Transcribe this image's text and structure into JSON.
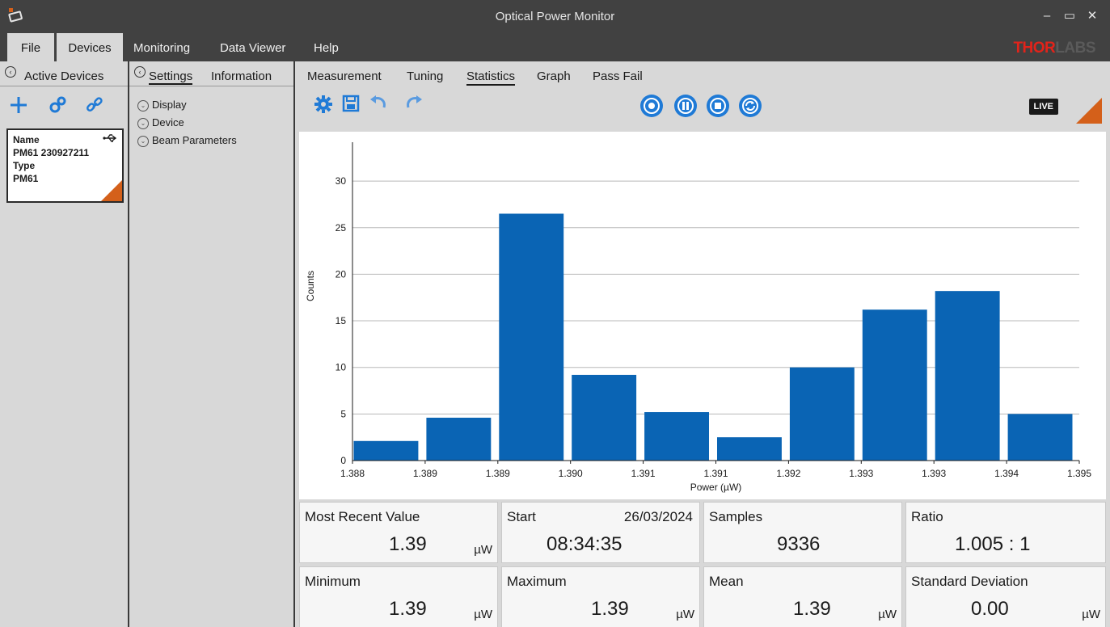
{
  "window": {
    "title": "Optical Power Monitor",
    "minimize": "–",
    "restore": "▭",
    "close": "✕"
  },
  "menu": {
    "file": "File",
    "devices": "Devices",
    "monitoring": "Monitoring",
    "data_viewer": "Data Viewer",
    "help": "Help"
  },
  "brand": {
    "logo_part1": "THOR",
    "logo_part2": "LABS",
    "accent": "#d4601a",
    "primary": "#1f7ad6"
  },
  "devices_panel": {
    "title": "Active Devices",
    "card": {
      "name_label": "Name",
      "name_value": "PM61 230927211",
      "type_label": "Type",
      "type_value": "PM61"
    }
  },
  "settings_panel": {
    "tabs": [
      "Settings",
      "Information"
    ],
    "tree": [
      "Display",
      "Device",
      "Beam Parameters"
    ]
  },
  "main_tabs": [
    "Measurement",
    "Tuning",
    "Statistics",
    "Graph",
    "Pass Fail"
  ],
  "live_label": "LIVE",
  "chart_data": {
    "type": "bar",
    "xlabel": "Power (µW)",
    "ylabel": "Counts",
    "ylim": [
      0,
      34
    ],
    "y_ticks": [
      0,
      5,
      10,
      15,
      20,
      25,
      30
    ],
    "x_ticks": [
      "1.388",
      "1.389",
      "1.389",
      "1.390",
      "1.391",
      "1.391",
      "1.392",
      "1.393",
      "1.393",
      "1.394",
      "1.395"
    ],
    "values": [
      2.1,
      4.6,
      26.5,
      9.2,
      5.2,
      2.5,
      10.0,
      16.2,
      18.2,
      5.0
    ],
    "bar_color": "#0a64b4"
  },
  "stats": {
    "most_recent": {
      "label": "Most Recent Value",
      "value": "1.39",
      "unit": "µW"
    },
    "start": {
      "label": "Start",
      "date": "26/03/2024",
      "time": "08:34:35"
    },
    "samples": {
      "label": "Samples",
      "value": "9336"
    },
    "ratio": {
      "label": "Ratio",
      "value": "1.005 : 1"
    },
    "minimum": {
      "label": "Minimum",
      "value": "1.39",
      "unit": "µW"
    },
    "maximum": {
      "label": "Maximum",
      "value": "1.39",
      "unit": "µW"
    },
    "mean": {
      "label": "Mean",
      "value": "1.39",
      "unit": "µW"
    },
    "std": {
      "label": "Standard Deviation",
      "value": "0.00",
      "unit": "µW"
    }
  }
}
